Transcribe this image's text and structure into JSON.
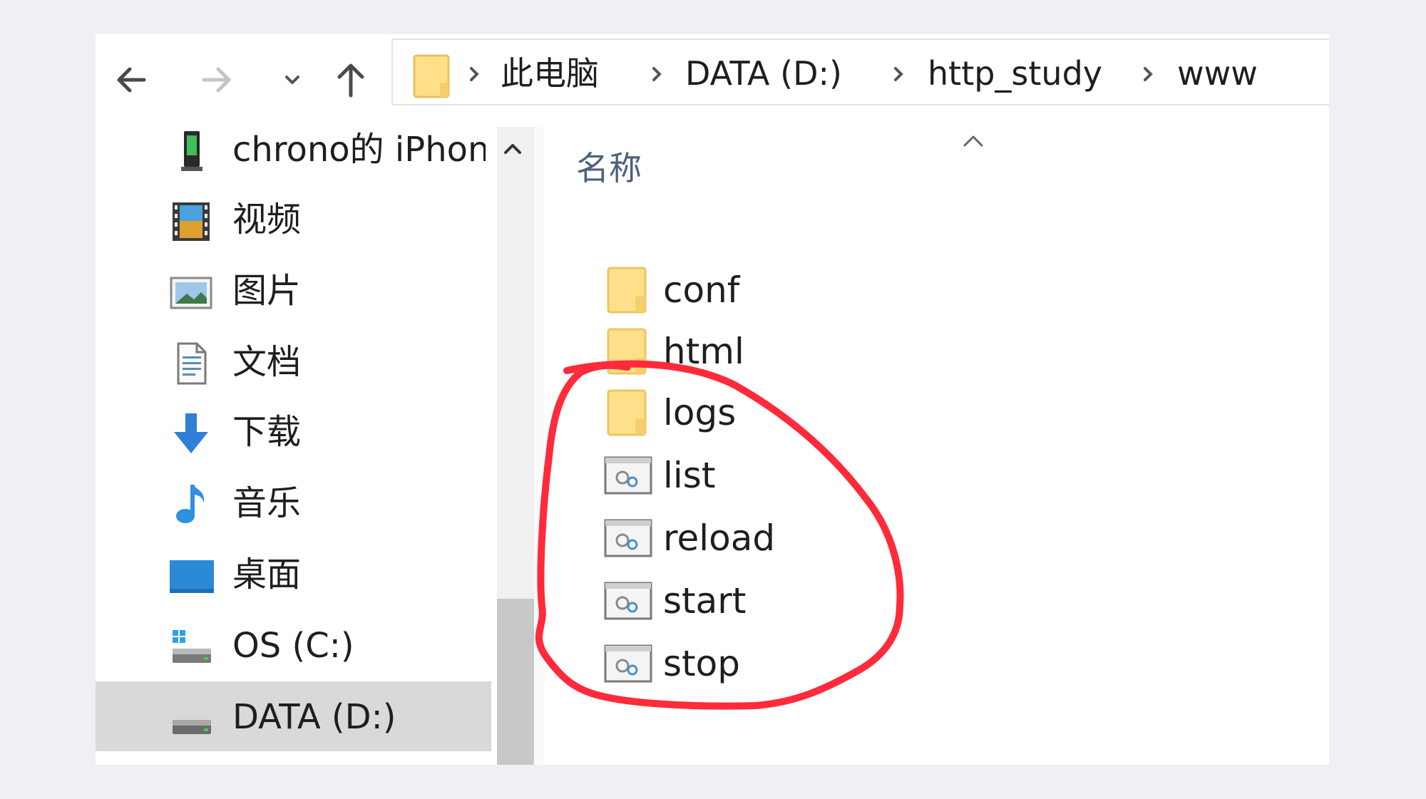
{
  "toolbar": {
    "back_icon": "arrow-left-icon",
    "forward_icon": "arrow-right-icon",
    "recent_icon": "chevron-down-icon",
    "up_icon": "arrow-up-icon"
  },
  "address_bar": {
    "icon": "folder-icon",
    "crumbs": [
      "此电脑",
      "DATA (D:)",
      "http_study",
      "www"
    ]
  },
  "sidebar": {
    "items": [
      {
        "label": "chrono的 iPhone",
        "icon": "phone-icon"
      },
      {
        "label": "视频",
        "icon": "video-icon"
      },
      {
        "label": "图片",
        "icon": "pictures-icon"
      },
      {
        "label": "文档",
        "icon": "documents-icon"
      },
      {
        "label": "下载",
        "icon": "download-icon"
      },
      {
        "label": "音乐",
        "icon": "music-icon"
      },
      {
        "label": "桌面",
        "icon": "desktop-icon"
      },
      {
        "label": "OS (C:)",
        "icon": "windows-drive-icon"
      },
      {
        "label": "DATA (D:)",
        "icon": "drive-icon",
        "selected": true
      }
    ]
  },
  "file_list": {
    "column_header": "名称",
    "sort": "ascending",
    "files": [
      {
        "name": "conf",
        "type": "folder"
      },
      {
        "name": "html",
        "type": "folder"
      },
      {
        "name": "logs",
        "type": "folder"
      },
      {
        "name": "list",
        "type": "batch-file"
      },
      {
        "name": "reload",
        "type": "batch-file"
      },
      {
        "name": "start",
        "type": "batch-file"
      },
      {
        "name": "stop",
        "type": "batch-file"
      }
    ]
  },
  "colors": {
    "background": "#f0f0f4",
    "selected_item": "#d9d9d9",
    "folder_yellow": "#ffe08a",
    "annotation_red": "#ff2a3a",
    "column_header_text": "#4c607a"
  }
}
